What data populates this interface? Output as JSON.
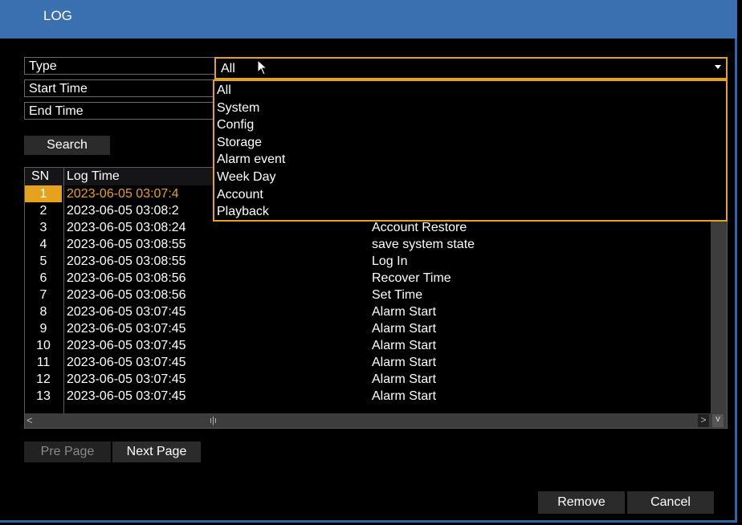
{
  "window": {
    "title": "LOG"
  },
  "form": {
    "type_label": "Type",
    "type_value": "All",
    "start_label": "Start Time",
    "end_label": "End Time",
    "search_label": "Search"
  },
  "dropdown": {
    "options": [
      "All",
      "System",
      "Config",
      "Storage",
      "Alarm event",
      "Week Day",
      "Account",
      "Playback"
    ]
  },
  "table": {
    "headers": {
      "sn": "SN",
      "time": "Log Time",
      "type": ""
    },
    "rows": [
      {
        "sn": "1",
        "time": "2023-06-05 03:07:4",
        "type": ""
      },
      {
        "sn": "2",
        "time": "2023-06-05 03:08:2",
        "type": ""
      },
      {
        "sn": "3",
        "time": "2023-06-05 03:08:24",
        "type": "Account Restore"
      },
      {
        "sn": "4",
        "time": "2023-06-05 03:08:55",
        "type": "save system state"
      },
      {
        "sn": "5",
        "time": "2023-06-05 03:08:55",
        "type": "Log In"
      },
      {
        "sn": "6",
        "time": "2023-06-05 03:08:56",
        "type": "Recover Time"
      },
      {
        "sn": "7",
        "time": "2023-06-05 03:08:56",
        "type": "Set Time"
      },
      {
        "sn": "8",
        "time": "2023-06-05 03:07:45",
        "type": "Alarm Start"
      },
      {
        "sn": "9",
        "time": "2023-06-05 03:07:45",
        "type": "Alarm Start"
      },
      {
        "sn": "10",
        "time": "2023-06-05 03:07:45",
        "type": "Alarm Start"
      },
      {
        "sn": "11",
        "time": "2023-06-05 03:07:45",
        "type": "Alarm Start"
      },
      {
        "sn": "12",
        "time": "2023-06-05 03:07:45",
        "type": "Alarm Start"
      },
      {
        "sn": "13",
        "time": "2023-06-05 03:07:45",
        "type": "Alarm Start"
      }
    ],
    "selected_sn": "1",
    "scroll": {
      "left": "<",
      "thumb": "ı|ı",
      "right": ">",
      "down": "v"
    }
  },
  "paging": {
    "prev_label": "Pre Page",
    "next_label": "Next Page"
  },
  "footer": {
    "remove_label": "Remove",
    "cancel_label": "Cancel"
  },
  "colors": {
    "accent": "#e6a21c",
    "titlebar": "#3a70b0"
  },
  "icons": {
    "cursor": "pointer-arrow-icon",
    "caret": "chevron-down-icon"
  }
}
